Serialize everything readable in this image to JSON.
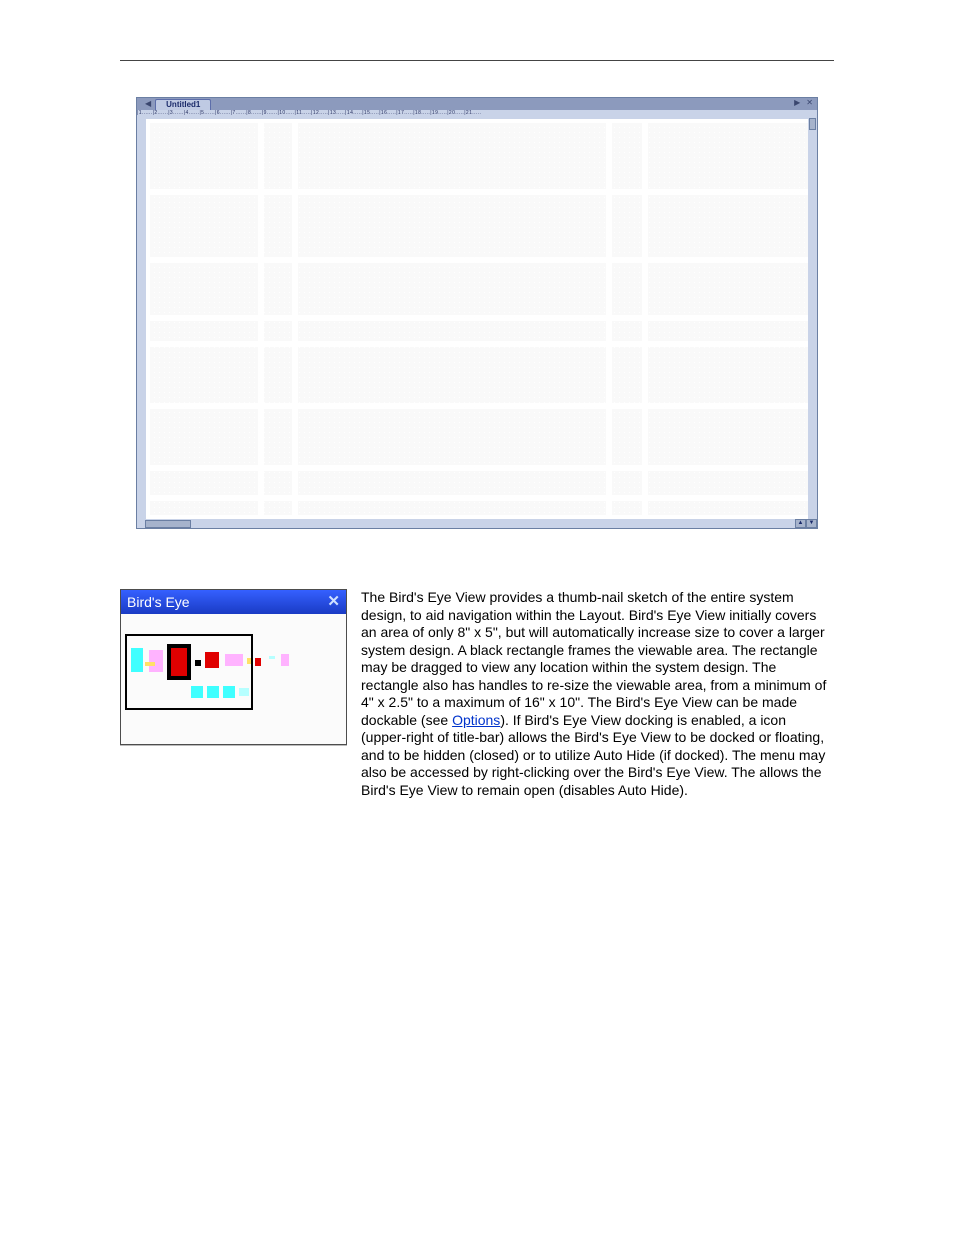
{
  "layoutwin": {
    "tab": "Untitled1",
    "arrow_l": "◀",
    "arrow_r": "▶",
    "close_x": "✕",
    "h_ruler": "|1......|2......|3......|4......|5......|6......|7......|8......|9......|10.....|11.....|12.....|13.....|14.....|15.....|16.....|17.....|18.....|19.....|20.....|21....."
  },
  "birdseye": {
    "title": "Bird's Eye",
    "close": "✕"
  },
  "para": {
    "t1": "The Bird's Eye View provides a thumb-nail sketch of the entire system design, to aid navigation within the Layout. Bird's Eye View initially covers an area of only 8\" x 5\", but will automatically increase size to cover a larger system design. A black rectangle frames the viewable area. The rectangle may be dragged to view any location within the system design. The rectangle also has handles to re-size the viewable area, from a minimum of 4\" x 2.5\" to a maximum of 16\" x 10\". The Bird's Eye View can be made dockable (see ",
    "link1": "Options",
    "t2": "). If Bird's Eye View docking is enabled, a ",
    "t3": " icon (upper-right of title-bar) allows the Bird's Eye View to be docked or floating, and to be hidden (closed) or to utilize Auto Hide (if docked). The menu may also be accessed by right-clicking over the Bird's Eye View. The ",
    "t4": " allows the Bird's Eye View to remain open (disables Auto Hide)."
  }
}
